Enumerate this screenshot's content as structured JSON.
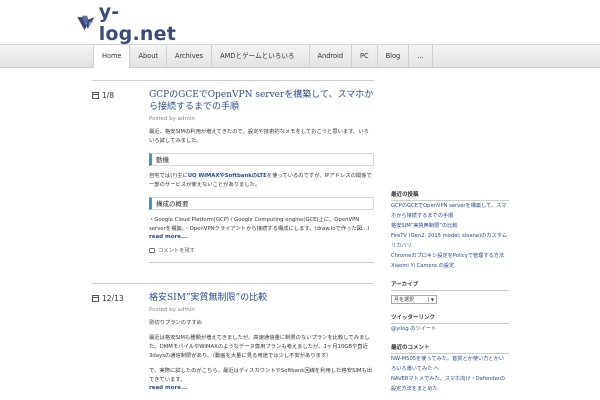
{
  "site": {
    "name": "y-log.net"
  },
  "nav": [
    "Home",
    "About",
    "Archives",
    "AMDとゲームといろいろ",
    "Android",
    "PC",
    "Blog",
    "..."
  ],
  "posts": [
    {
      "date": "1/8",
      "title": "GCPのGCEでOpenVPN serverを構築して、スマホから接続するまでの手順",
      "meta": "Posted by admin",
      "intro": "最近、格安SIMの利用が増えてきたので、設定や技術的なメモをしておこうと思います。いろいろ試してみました。",
      "h1": "動機",
      "p1a": "自宅では(?)主に",
      "p1b": "UQ WiMAXやSoftbankのLTE",
      "p1c": "を使っているのですが、IPアドレスの関係で一部のサービスが使えないことがありました。",
      "h2": "構成の概要",
      "p2": "・Google Cloud Platform(GCP) / Google Computing engine(GCE)上に、OpenVPN serverを構築。・OpenVPNクライアントから接続する構成にします。(draw.ioで作った図…)",
      "more": "read more...",
      "comment": "コメントを残す"
    },
    {
      "date": "12/13",
      "title": "格安SIM”実質無制限”の比較",
      "meta": "Posted by admin",
      "lead": "別切りプランのすすめ",
      "p1": "最近は格安SIMも種類が増えてきましたが、高速通信量に制限のないプランを比較してみました。DMMモバイルやWiMAXのようなデータ専用プランも考えましたが、1ヶ月10GBや直近3daysの通信制限があり、（動画を大量に見る用途では少し不安があります）",
      "p2": "で、実際に試したのがこちら。最近はディスカウントやSoftbank回線を利用した格安SIMも出てきています。",
      "more": "read more..."
    }
  ],
  "sidebar": {
    "recent_title": "最近の投稿",
    "recent": [
      "GCPのGCEでOpenVPN serverを構築して、スマホから接続するまでの手順",
      "格安SIM”実質無制限”の比較",
      "FireTV (Gen2, 2015 model; sloane)のカスタムリカバリ",
      "Chromeのプロキシ設定をPolicyで管理する方法",
      "Xiaomi Yi Camera の設定"
    ],
    "archive_title": "アーカイブ",
    "archive_select": "月を選択",
    "twitter_title": "ツイッターリンク",
    "twitter_link": "@yilog のツイート",
    "recent2_title": "最近のコメント",
    "recent2": [
      "NW-M505を使ってみた。音質とか使い方とかいろいろ書いてみた へ",
      "NAVERマトメでみた、スマホ向け・Defenderの設定方法をまとめた"
    ]
  }
}
